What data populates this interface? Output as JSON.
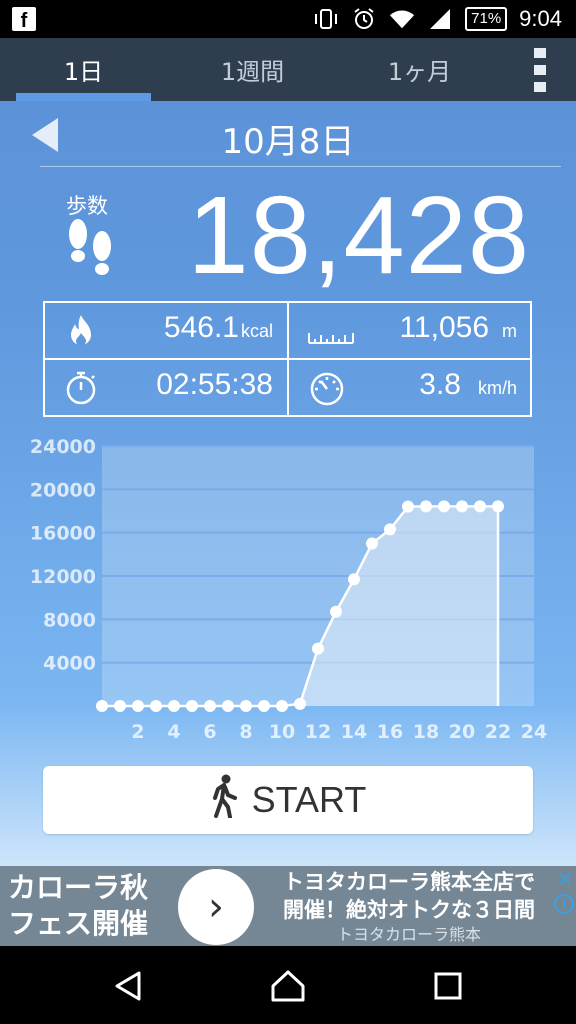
{
  "status_bar": {
    "time": "9:04",
    "battery": "71%"
  },
  "tabs": [
    {
      "label": "1日"
    },
    {
      "label": "1週間"
    },
    {
      "label": "1ヶ月"
    }
  ],
  "date": "10月8日",
  "steps": {
    "label": "歩数",
    "value": "18,428"
  },
  "stats": {
    "calories": {
      "value": "546.1",
      "unit": "kcal"
    },
    "distance": {
      "value": "11,056",
      "unit": "m"
    },
    "time": {
      "value": "02:55:38"
    },
    "speed": {
      "value": "3.8",
      "unit": "km/h"
    }
  },
  "chart_data": {
    "type": "area",
    "x": [
      0,
      1,
      2,
      3,
      4,
      5,
      6,
      7,
      8,
      9,
      10,
      11,
      12,
      13,
      14,
      15,
      16,
      17,
      18,
      19,
      20,
      21,
      22
    ],
    "values": [
      0,
      0,
      0,
      0,
      0,
      0,
      0,
      0,
      0,
      0,
      0,
      200,
      5300,
      8700,
      11700,
      15000,
      16300,
      18400,
      18428,
      18428,
      18428,
      18428,
      18428
    ],
    "xticks": [
      "2",
      "4",
      "6",
      "8",
      "10",
      "12",
      "14",
      "16",
      "18",
      "20",
      "22",
      "24"
    ],
    "yticks": [
      "4000",
      "8000",
      "12000",
      "16000",
      "20000",
      "24000"
    ],
    "xlim": [
      0,
      24
    ],
    "ylim": [
      0,
      24000
    ],
    "grid": true
  },
  "start_button": {
    "label": "START"
  },
  "ad": {
    "left_line1": "カローラ秋",
    "left_line2": "フェス開催",
    "right_line1": "トヨタカローラ熊本全店で",
    "right_line2": "開催！絶対オトクな３日間",
    "sponsor": "トヨタカローラ熊本",
    "close": "✕",
    "info": "i"
  },
  "colors": {
    "tab_bar": "#2f3e4e",
    "accent": "#5b9be6",
    "ad_bg": "#758795"
  }
}
